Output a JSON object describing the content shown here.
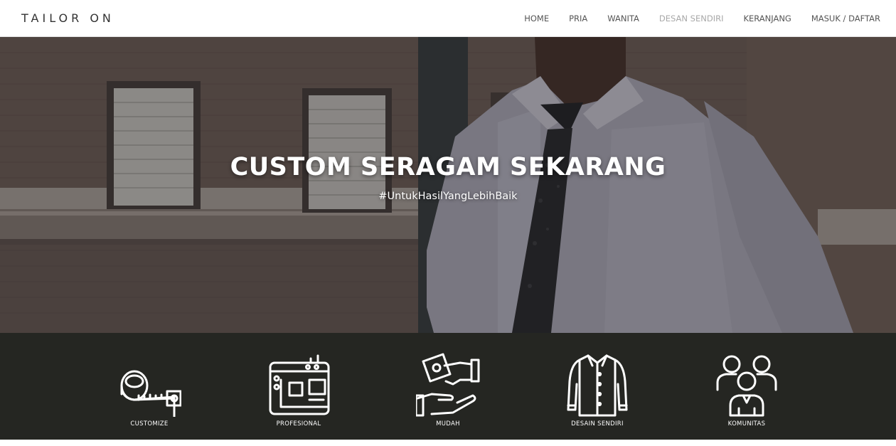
{
  "brand": {
    "name": "TAILOR ON"
  },
  "nav": {
    "items": [
      {
        "label": "HOME"
      },
      {
        "label": "PRIA"
      },
      {
        "label": "WANITA"
      },
      {
        "label": "DESAN SENDIRI"
      },
      {
        "label": "KERANJANG"
      },
      {
        "label": "MASUK / DAFTAR"
      }
    ]
  },
  "hero": {
    "title": "CUSTOM SERAGAM SEKARANG",
    "subtitle": "#UntukHasilYangLebihBaik"
  },
  "features": {
    "items": [
      {
        "label": "CUSTOMIZE",
        "icon": "measuring-tape-icon"
      },
      {
        "label": "PROFESIONAL",
        "icon": "sewing-machine-icon"
      },
      {
        "label": "MUDAH",
        "icon": "hand-money-icon"
      },
      {
        "label": "DESAIN SENDIRI",
        "icon": "shirt-icon"
      },
      {
        "label": "KOMUNITAS",
        "icon": "community-icon"
      }
    ]
  },
  "colors": {
    "feature_bg": "#252622",
    "nav_text": "#555555",
    "nav_muted": "#a8a8a8"
  }
}
